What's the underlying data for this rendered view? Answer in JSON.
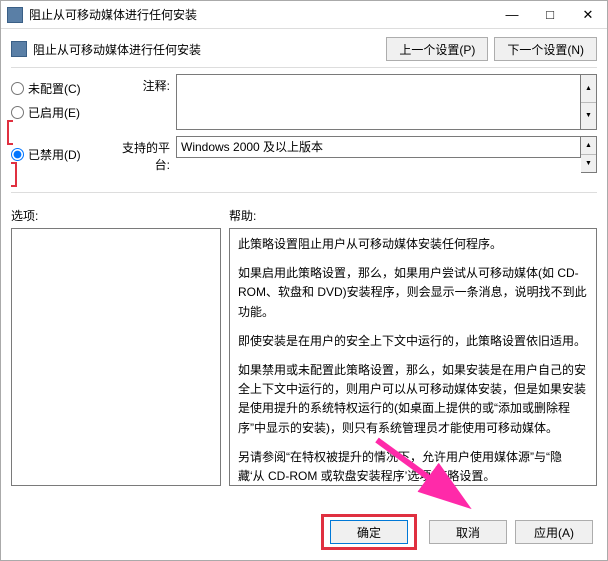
{
  "titlebar": {
    "title": "阻止从可移动媒体进行任何安装"
  },
  "header": {
    "policy_name": "阻止从可移动媒体进行任何安装",
    "prev_button": "上一个设置(P)",
    "next_button": "下一个设置(N)"
  },
  "radio": {
    "not_configured": "未配置(C)",
    "enabled": "已启用(E)",
    "disabled": "已禁用(D)",
    "selected": "disabled"
  },
  "fields": {
    "comment_label": "注释:",
    "comment_value": "",
    "platform_label": "支持的平台:",
    "platform_value": "Windows 2000 及以上版本"
  },
  "sections": {
    "options_label": "选项:",
    "help_label": "帮助:"
  },
  "help": {
    "p1": "此策略设置阻止用户从可移动媒体安装任何程序。",
    "p2": "如果启用此策略设置，那么，如果用户尝试从可移动媒体(如 CD-ROM、软盘和 DVD)安装程序，则会显示一条消息，说明找不到此功能。",
    "p3": "即使安装是在用户的安全上下文中运行的，此策略设置依旧适用。",
    "p4": "如果禁用或未配置此策略设置，那么，如果安装是在用户自己的安全上下文中运行的，则用户可以从可移动媒体安装，但是如果安装是使用提升的系统特权运行的(如桌面上提供的或“添加或删除程序”中显示的安装)，则只有系统管理员才能使用可移动媒体。",
    "p5": "另请参阅“在特权被提升的情况下，允许用户使用媒体源”与“隐藏‘从 CD-ROM 或软盘安装程序’选项”策略设置。"
  },
  "footer": {
    "ok": "确定",
    "cancel": "取消",
    "apply": "应用(A)"
  },
  "colors": {
    "highlight": "#e03040",
    "arrow": "#ff2aa9"
  }
}
